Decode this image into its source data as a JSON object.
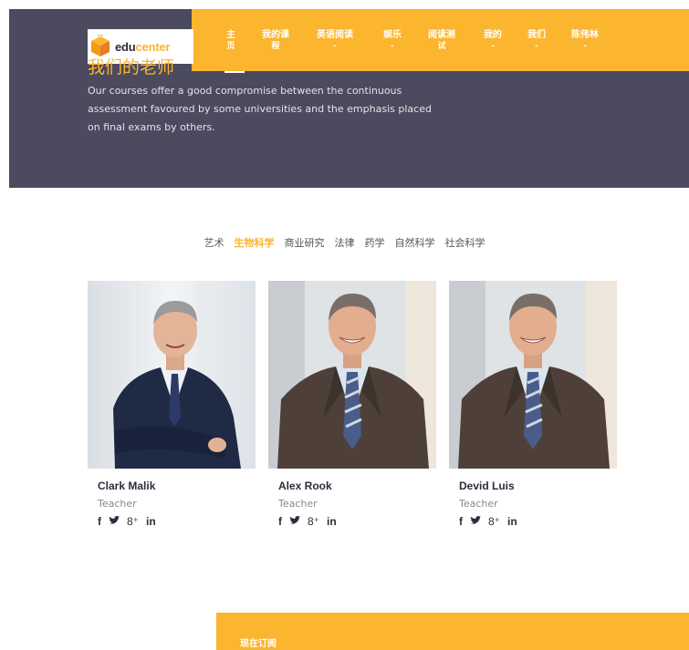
{
  "logo": {
    "edu": "edu",
    "center": "center"
  },
  "nav": {
    "items": [
      {
        "line1": "主",
        "line2": "页"
      },
      {
        "line1": "我的课",
        "line2": "程"
      },
      {
        "line1": "英语阅读",
        "line2": "-"
      },
      {
        "line1": "娱乐",
        "line2": "-"
      },
      {
        "line1": "阅读测",
        "line2": "试"
      },
      {
        "line1": "我的",
        "line2": "-"
      },
      {
        "line1": "我们",
        "line2": "-"
      },
      {
        "line1": "陈伟林",
        "line2": "-"
      }
    ]
  },
  "hero": {
    "title": "我们的老师",
    "description": "Our courses offer a good compromise between the continuous assessment favoured by some universities and the emphasis placed on final exams by others."
  },
  "tabs": {
    "items": [
      "艺术",
      "生物科学",
      "商业研究",
      "法律",
      "药学",
      "自然科学",
      "社会科学"
    ],
    "active": "生物科学"
  },
  "teachers": [
    {
      "name": "Clark Malik",
      "role": "Teacher"
    },
    {
      "name": "Alex Rook",
      "role": "Teacher"
    },
    {
      "name": "Devid Luis",
      "role": "Teacher"
    }
  ],
  "socials": {
    "facebook": "f",
    "twitter": "🐦",
    "google": "8⁺",
    "linkedin": "in"
  },
  "subscribe": {
    "label": "现在订阅"
  },
  "colors": {
    "accent": "#fbb52e",
    "hero_bg": "#4b4a5e"
  }
}
